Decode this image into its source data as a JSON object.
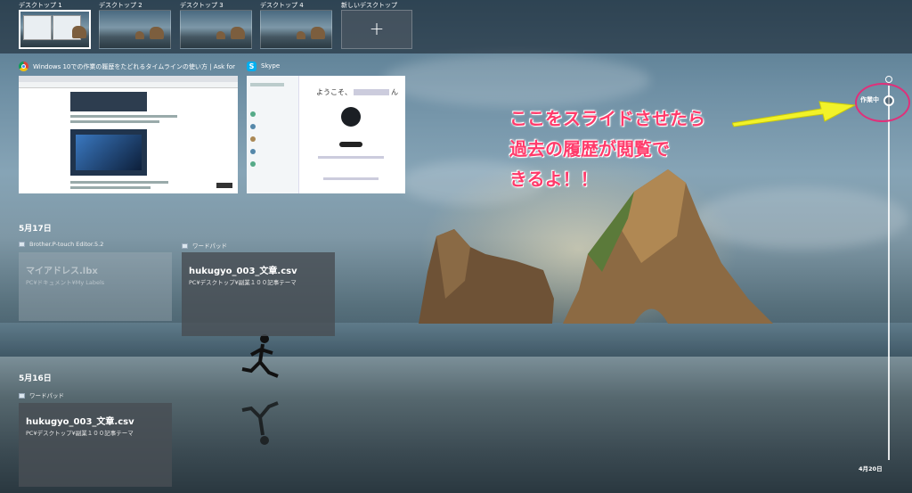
{
  "virtual_desktops": {
    "items": [
      {
        "label": "デスクトップ 1"
      },
      {
        "label": "デスクトップ 2"
      },
      {
        "label": "デスクトップ 3"
      },
      {
        "label": "デスクトップ 4"
      }
    ],
    "new_label": "新しいデスクトップ",
    "new_symbol": "+"
  },
  "windows": [
    {
      "title": "Windows 10での作業の履歴をたどれるタイムラインの使い方 | Ask for Window...",
      "icon": "chrome-icon"
    },
    {
      "title": "Skype",
      "icon": "skype-icon",
      "icon_glyph": "S",
      "welcome": "ようこそ、",
      "welcome_suffix": "ん"
    }
  ],
  "timeline": {
    "days": [
      {
        "label": "5月17日",
        "activities": [
          {
            "app": "Brother.P-touch Editor.5.2",
            "title": "マイアドレス.lbx",
            "path": "PC¥ドキュメント¥My Labels",
            "faded": true
          },
          {
            "app": "ワードパッド",
            "title": "hukugyo_003_文章.csv",
            "path": "PC¥デスクトップ¥副業１００記事テーマ",
            "faded": false
          }
        ]
      },
      {
        "label": "5月16日",
        "activities": [
          {
            "app": "ワードパッド",
            "title": "hukugyo_003_文章.csv",
            "path": "PC¥デスクトップ¥副業１００記事テーマ",
            "faded": false
          }
        ]
      }
    ],
    "scroll_now_label": "作業中",
    "scroll_end_date": "4月20日"
  },
  "annotation": {
    "lines": [
      "ここをスライドさせたら",
      "過去の履歴が閲覧で",
      "きるよ！！"
    ],
    "color": "#ff3b6b",
    "arrow_color": "#f2f229"
  }
}
